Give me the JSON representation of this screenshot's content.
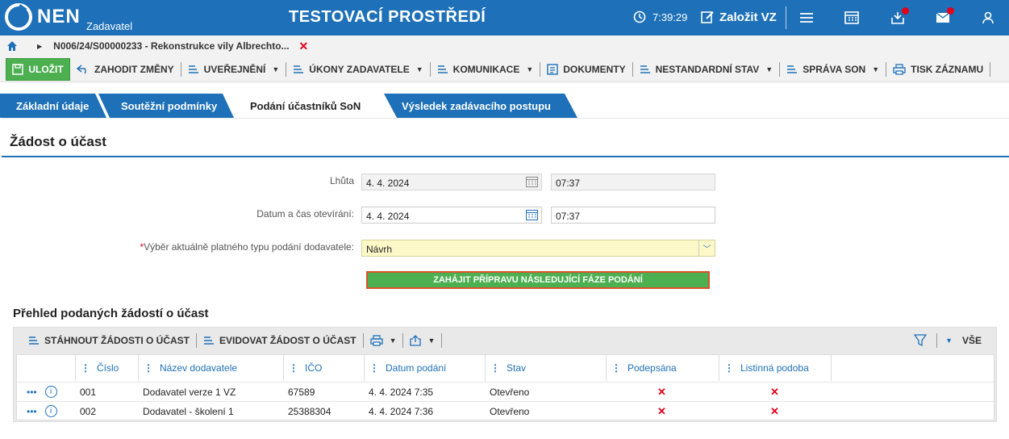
{
  "header": {
    "logo_text": "NEN",
    "logo_sub": "Zadavatel",
    "env_title": "TESTOVACÍ PROSTŘEDÍ",
    "time": "7:39:29",
    "create_label": "Založit VZ"
  },
  "breadcrumb": {
    "text": "N006/24/S00000233 - Rekonstrukce vily Albrechto..."
  },
  "toolbar": {
    "save": "ULOŽIT",
    "discard": "ZAHODIT ZMĚNY",
    "publish": "UVEŘEJNĚNÍ",
    "actions": "ÚKONY ZADAVATELE",
    "communication": "KOMUNIKACE",
    "documents": "DOKUMENTY",
    "nonstandard": "NESTANDARDNÍ STAV",
    "son": "SPRÁVA SON",
    "print": "TISK ZÁZNAMU"
  },
  "tabs": [
    "Základní údaje",
    "Soutěžní podmínky",
    "Podání účastníků SoN",
    "Výsledek zadávacího postupu"
  ],
  "form": {
    "section_title": "Žádost o účast",
    "deadline_label": "Lhůta",
    "deadline_date": "4. 4. 2024",
    "deadline_time": "07:37",
    "open_label": "Datum a čas otevírání:",
    "open_date": "4. 4. 2024",
    "open_time": "07:37",
    "type_label": "Výběr aktuálně platného typu podání dodavatele:",
    "type_value": "Návrh",
    "phase_button": "ZAHÁJIT PŘÍPRAVU NÁSLEDUJÍCÍ FÁZE PODÁNÍ"
  },
  "list": {
    "title": "Přehled podaných žádostí o účast",
    "download": "STÁHNOUT ŽÁDOSTI O ÚČAST",
    "record": "EVIDOVAT ŽÁDOST O ÚČAST",
    "all": "VŠE",
    "columns": [
      "Číslo",
      "Název dodavatele",
      "IČO",
      "Datum podání",
      "Stav",
      "Podepsána",
      "Listinná podoba"
    ],
    "rows": [
      {
        "cislo": "001",
        "nazev": "Dodavatel verze 1 VZ",
        "ico": "67589",
        "datum": "4. 4. 2024 7:35",
        "stav": "Otevřeno",
        "podepsana": "✕",
        "listinna": "✕"
      },
      {
        "cislo": "002",
        "nazev": "Dodavatel - školení 1",
        "ico": "25388304",
        "datum": "4. 4. 2024 7:36",
        "stav": "Otevřeno",
        "podepsana": "✕",
        "listinna": "✕"
      }
    ]
  },
  "colors": {
    "brand": "#1e71b8",
    "save_green": "#4caf50",
    "alert_red": "#e2001a",
    "mandatory_yellow": "#fdf8c8"
  }
}
